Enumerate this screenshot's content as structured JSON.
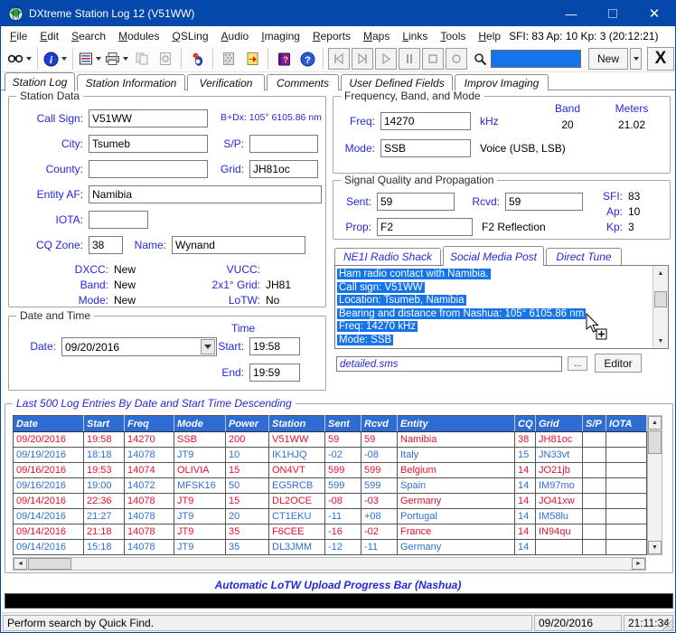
{
  "colors": {
    "titlebar": "#0448ac",
    "window-frame": "#0448ac",
    "label-blue": "#2626dd",
    "table-header": "#2e6bd3",
    "row-red": "#e8112d",
    "row-blue": "#2f6fd8",
    "selection-blue": "#1574e8"
  },
  "titlebar": {
    "title": "DXtreme Station Log 12 (V51WW)",
    "icon": "globe-icon",
    "minimize": "—",
    "close": "✕"
  },
  "menubar": {
    "items": [
      "File",
      "Edit",
      "Search",
      "Modules",
      "QSLing",
      "Audio",
      "Imaging",
      "Reports",
      "Maps",
      "Links",
      "Tools",
      "Help"
    ],
    "solar_status": "SFI: 83 Ap: 10 Kp: 3 (20:12:21)"
  },
  "toolbar": {
    "icons": [
      "find-icon",
      "info-icon",
      "log-list-icon",
      "print-icon",
      "copy-icon",
      "print-preview-icon",
      "dx-alert-bird-icon",
      "pattern-icon",
      "exit-icon",
      "qsl-book-icon",
      "help-icon",
      "nav-first-icon",
      "nav-last-icon",
      "nav-play-icon",
      "nav-pause-icon",
      "nav-stop-icon",
      "nav-record-icon",
      "quick-find-icon"
    ],
    "search_value": "",
    "new_label": "New",
    "close_label": "X"
  },
  "main_tabs": [
    "Station Log",
    "Station Information",
    "Verification",
    "Comments",
    "User Defined Fields",
    "Improv Imaging"
  ],
  "station_data": {
    "legend": "Station Data",
    "call_sign_label": "Call Sign:",
    "call_sign": "V51WW",
    "bearing_distance": "B+Dx: 105° 6105.86 nm",
    "city_label": "City:",
    "city": "Tsumeb",
    "sp_label": "S/P:",
    "sp": "",
    "county_label": "County:",
    "county": "",
    "grid_label": "Grid:",
    "grid": "JH81oc",
    "entity_label": "Entity AF:",
    "entity": "Namibia",
    "iota_label": "IOTA:",
    "iota": "",
    "cq_zone_label": "CQ Zone:",
    "cq_zone": "38",
    "name_label": "Name:",
    "name": "Wynand",
    "dxcc_label": "DXCC:",
    "dxcc": "New",
    "band_label": "Band:",
    "band": "New",
    "mode_label": "Mode:",
    "mode": "New",
    "vucc_label": "VUCC:",
    "vucc": "",
    "grid2_label": "2x1° Grid:",
    "grid2": "JH81",
    "lotw_label": "LoTW:",
    "lotw": "No"
  },
  "date_time": {
    "legend": "Date and Time",
    "time_header": "Time",
    "date_label": "Date:",
    "date": "09/20/2016",
    "start_label": "Start:",
    "start": "19:58",
    "end_label": "End:",
    "end": "19:59"
  },
  "freq_mode": {
    "legend": "Frequency, Band, and Mode",
    "freq_label": "Freq:",
    "freq": "14270",
    "unit": "kHz",
    "band_header": "Band",
    "band": "20",
    "meters_header": "Meters",
    "meters": "21.02",
    "mode_label": "Mode:",
    "mode": "SSB",
    "mode_desc": "Voice (USB, LSB)"
  },
  "signal": {
    "legend": "Signal Quality and Propagation",
    "sent_label": "Sent:",
    "sent": "59",
    "rcvd_label": "Rcvd:",
    "rcvd": "59",
    "prop_label": "Prop:",
    "prop": "F2",
    "prop_desc": "F2 Reflection",
    "sfi_label": "SFI:",
    "sfi": "83",
    "ap_label": "Ap:",
    "ap": "10",
    "kp_label": "Kp:",
    "kp": "3"
  },
  "social": {
    "tabs": [
      "NE1I Radio Shack",
      "Social Media Post",
      "Direct Tune"
    ],
    "active_tab": "Social Media Post",
    "lines": [
      "Ham radio contact with Namibia.",
      "Call sign: V51WW",
      "Location: Tsumeb, Namibia",
      "Bearing and distance from Nashua: 105° 6105.86 nm",
      "Freq: 14270 kHz",
      "Mode: SSB"
    ],
    "file": "detailed.sms",
    "browse_label": "...",
    "editor_label": "Editor"
  },
  "log": {
    "legend": "Last 500 Log Entries By Date and Start Time Descending",
    "headers": [
      "Date",
      "Start",
      "Freq",
      "Mode",
      "Power",
      "Station",
      "Sent",
      "Rcvd",
      "Entity",
      "CQ",
      "Grid",
      "S/P",
      "IOTA"
    ],
    "rows": [
      {
        "color": "red",
        "cells": [
          "09/20/2016",
          "19:58",
          "14270",
          "SSB",
          "200",
          "V51WW",
          "59",
          "59",
          "Namibia",
          "38",
          "JH81oc",
          "",
          ""
        ]
      },
      {
        "color": "blue",
        "cells": [
          "09/19/2016",
          "18:18",
          "14078",
          "JT9",
          "10",
          "IK1HJQ",
          "-02",
          "-08",
          "Italy",
          "15",
          "JN33vt",
          "",
          ""
        ]
      },
      {
        "color": "red",
        "cells": [
          "09/16/2016",
          "19:53",
          "14074",
          "OLIVIA",
          "15",
          "ON4VT",
          "599",
          "599",
          "Belgium",
          "14",
          "JO21jb",
          "",
          ""
        ]
      },
      {
        "color": "blue",
        "cells": [
          "09/16/2016",
          "19:00",
          "14072",
          "MFSK16",
          "50",
          "EG5RCB",
          "599",
          "599",
          "Spain",
          "14",
          "IM97mo",
          "",
          ""
        ]
      },
      {
        "color": "red",
        "cells": [
          "09/14/2016",
          "22:36",
          "14078",
          "JT9",
          "15",
          "DL2OCE",
          "-08",
          "-03",
          "Germany",
          "14",
          "JO41xw",
          "",
          ""
        ]
      },
      {
        "color": "blue",
        "cells": [
          "09/14/2016",
          "21:27",
          "14078",
          "JT9",
          "20",
          "CT1EKU",
          "-11",
          "+08",
          "Portugal",
          "14",
          "IM58lu",
          "",
          ""
        ]
      },
      {
        "color": "red",
        "cells": [
          "09/14/2016",
          "21:18",
          "14078",
          "JT9",
          "35",
          "F6CEE",
          "-16",
          "-02",
          "France",
          "14",
          "IN94qu",
          "",
          ""
        ]
      },
      {
        "color": "blue",
        "cells": [
          "09/14/2016",
          "15:18",
          "14078",
          "JT9",
          "35",
          "DL3JMM",
          "-12",
          "-11",
          "Germany",
          "14",
          "",
          "",
          ""
        ]
      }
    ]
  },
  "footer": {
    "progress_label": "Automatic LoTW Upload Progress Bar (Nashua)"
  },
  "statusbar": {
    "message": "Perform search by Quick Find.",
    "date": "09/20/2016",
    "time": "21:11:34"
  }
}
